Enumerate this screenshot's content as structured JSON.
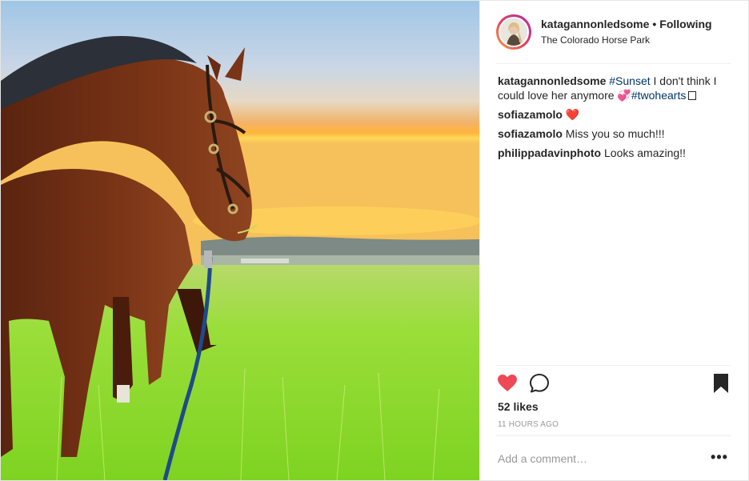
{
  "post": {
    "username": "katagannonledsome",
    "separator": "•",
    "follow_status": "Following",
    "location": "The Colorado Horse Park"
  },
  "photo": {
    "subject": "horse grazing at sunset"
  },
  "caption": {
    "user": "katagannonledsome",
    "hashtag_1": "#Sunset",
    "text_1": " I don't think I could love her anymore ",
    "emoji_1": "💞",
    "hashtag_2": "#twohearts",
    "emoji_2_icon": "unrendered-emoji-box"
  },
  "comments": [
    {
      "user": "sofiazamolo",
      "text": "❤️"
    },
    {
      "user": "sofiazamolo",
      "text": "Miss you so much!!!"
    },
    {
      "user": "philippadavinphoto",
      "text": "Looks amazing!!"
    }
  ],
  "actions": {
    "like_icon": "heart-filled-icon",
    "comment_icon": "comment-bubble-icon",
    "save_icon": "bookmark-filled-icon",
    "like_color": "#ed4956"
  },
  "likes": "52 likes",
  "timestamp": "11 HOURS AGO",
  "add_comment": {
    "placeholder": "Add a comment…",
    "more_label": "•••"
  }
}
